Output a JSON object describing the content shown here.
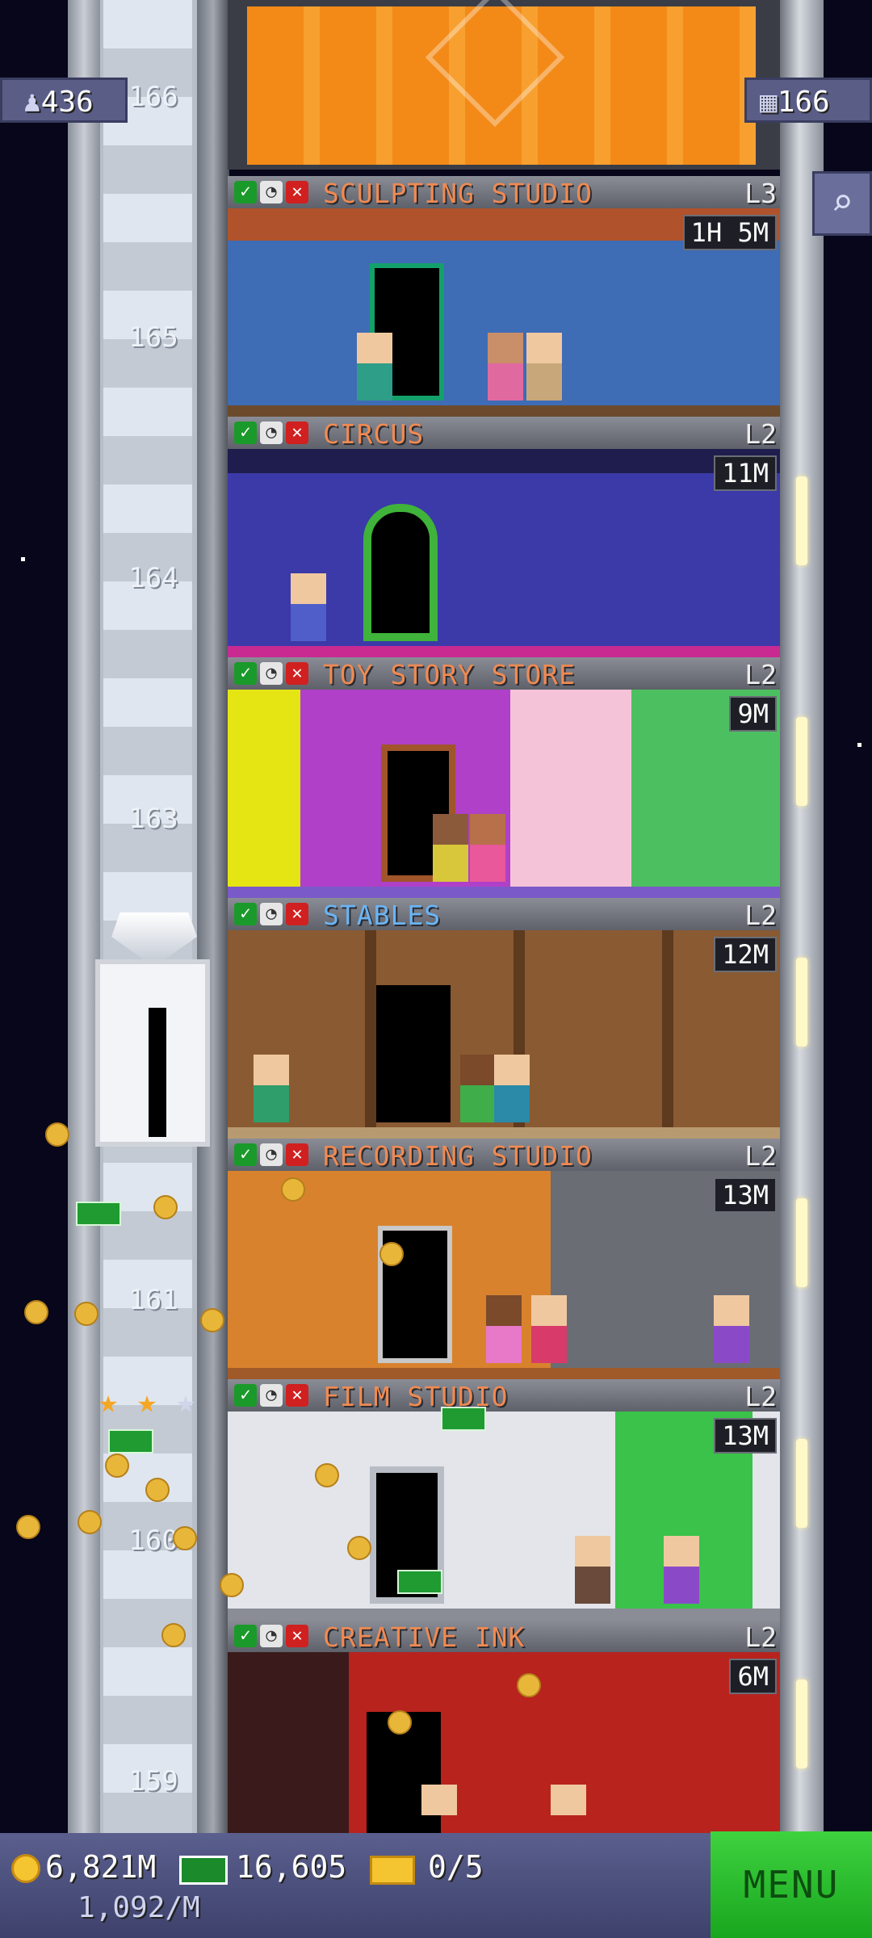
{
  "population": "436",
  "floor_count": "166",
  "colors": {
    "sculpting_studio": "#f08a52",
    "circus": "#f08a52",
    "toy_story_store": "#f08a52",
    "stables": "#6bb4f3",
    "recording_studio": "#f08a52",
    "film_studio": "#f08a52",
    "creative_ink": "#f08a52"
  },
  "shaft_floor_numbers": [
    "166",
    "165",
    "164",
    "163",
    "161",
    "160",
    "159"
  ],
  "floors": [
    {
      "name": "SCULPTING STUDIO",
      "level": "L3",
      "timer": "1H 5M"
    },
    {
      "name": "CIRCUS",
      "level": "L2",
      "timer": "11M"
    },
    {
      "name": "TOY STORY STORE",
      "level": "L2",
      "timer": "9M"
    },
    {
      "name": "STABLES",
      "level": "L2",
      "timer": "12M"
    },
    {
      "name": "RECORDING STUDIO",
      "level": "L2",
      "timer": "13M"
    },
    {
      "name": "FILM STUDIO",
      "level": "L2",
      "timer": "13M"
    },
    {
      "name": "CREATIVE INK",
      "level": "L2",
      "timer": "6M"
    }
  ],
  "elevator_stars": 2,
  "bottom_bar": {
    "coins": "6,821M",
    "coin_rate": "1,092/M",
    "bux": "16,605",
    "tickets": "0/5",
    "menu_label": "MENU"
  },
  "icons": {
    "population": "person-icon",
    "floors": "building-icon",
    "search": "magnifier-icon",
    "coin": "coin-icon",
    "bux": "bux-icon",
    "ticket": "golden-ticket-icon"
  }
}
